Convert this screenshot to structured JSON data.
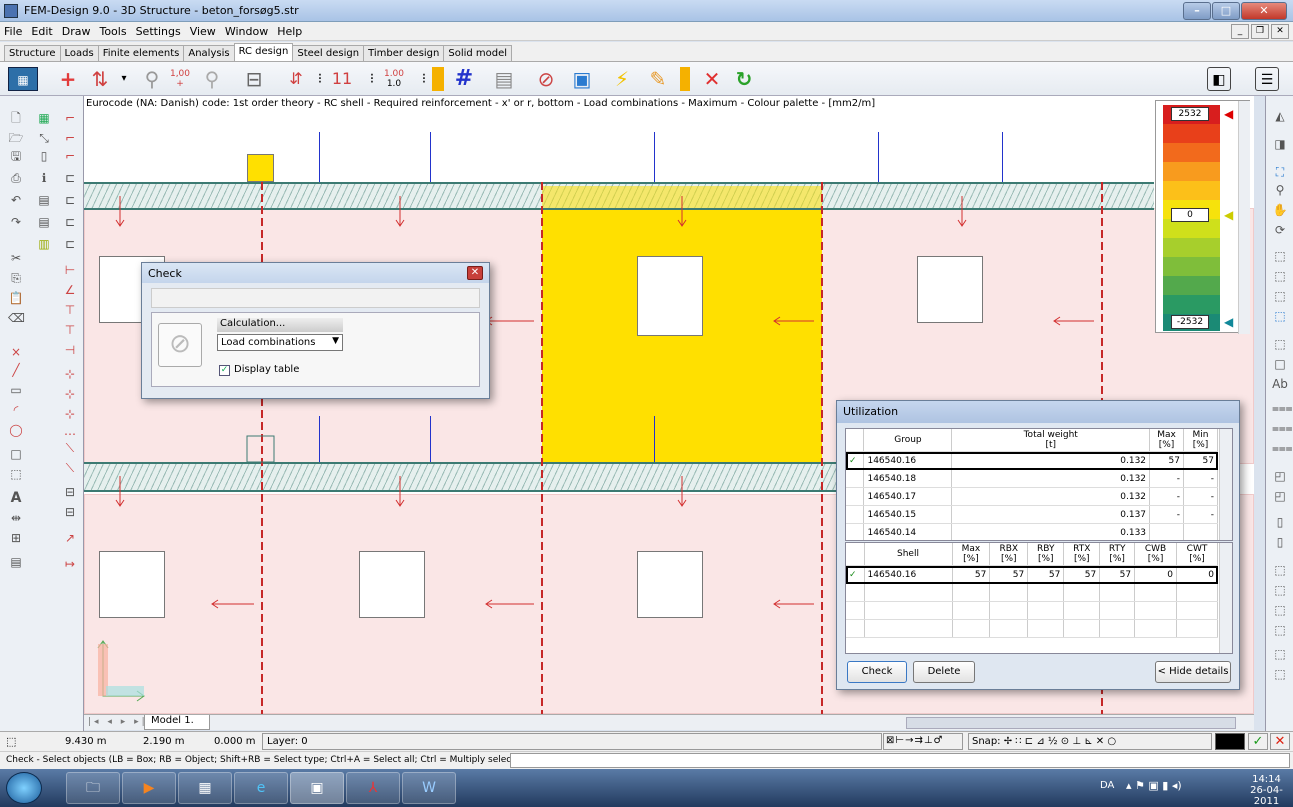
{
  "window": {
    "title": "FEM-Design 9.0 - 3D Structure - beton_forsøg5.str"
  },
  "menu": [
    "File",
    "Edit",
    "Draw",
    "Tools",
    "Settings",
    "View",
    "Window",
    "Help"
  ],
  "tabs": [
    {
      "label": "Structure",
      "active": false
    },
    {
      "label": "Loads",
      "active": false
    },
    {
      "label": "Finite elements",
      "active": false
    },
    {
      "label": "Analysis",
      "active": false
    },
    {
      "label": "RC design",
      "active": true
    },
    {
      "label": "Steel design",
      "active": false
    },
    {
      "label": "Timber design",
      "active": false
    },
    {
      "label": "Solid model",
      "active": false
    }
  ],
  "toolbar": {
    "num_a": "1,00",
    "num_b": "1.00",
    "num_c": "1.0"
  },
  "canvas": {
    "title": "Eurocode (NA: Danish) code: 1st order theory - RC shell - Required reinforcement - x' or r, bottom - Load combinations - Maximum - Colour palette - [mm2/m]"
  },
  "legend": {
    "max": "2532",
    "mid": "0",
    "min": "-2532",
    "colors": [
      "#d81e1e",
      "#e8401a",
      "#f26a1c",
      "#f89b1e",
      "#fcc019",
      "#f6e20c",
      "#cfe01b",
      "#a7cf2c",
      "#7fbe3a",
      "#53a94c",
      "#2a9a63",
      "#1b8a75"
    ]
  },
  "check_dialog": {
    "title": "Check",
    "calc_header": "Calculation...",
    "select_value": "Load combinations",
    "display_table_label": "Display table",
    "display_table_checked": true
  },
  "util_dialog": {
    "title": "Utilization",
    "group_cols": [
      "Group",
      "Total weight\n[t]",
      "Max\n[%]",
      "Min\n[%]"
    ],
    "group_rows": [
      {
        "check": "✓",
        "group": "146540.16",
        "weight": "0.132",
        "max": "57",
        "min": "57"
      },
      {
        "check": "",
        "group": "146540.18",
        "weight": "0.132",
        "max": "-",
        "min": "-"
      },
      {
        "check": "",
        "group": "146540.17",
        "weight": "0.132",
        "max": "-",
        "min": "-"
      },
      {
        "check": "",
        "group": "146540.15",
        "weight": "0.137",
        "max": "-",
        "min": "-"
      },
      {
        "check": "",
        "group": "146540.14",
        "weight": "0.133",
        "max": "",
        "min": ""
      }
    ],
    "shell_cols": [
      "Shell",
      "Max\n[%]",
      "RBX\n[%]",
      "RBY\n[%]",
      "RTX\n[%]",
      "RTY\n[%]",
      "CWB\n[%]",
      "CWT\n[%]"
    ],
    "shell_rows": [
      {
        "check": "✓",
        "shell": "146540.16",
        "max": "57",
        "rbx": "57",
        "rby": "57",
        "rtx": "57",
        "rty": "57",
        "cwb": "0",
        "cwt": "0"
      }
    ],
    "btn_check": "Check",
    "btn_delete": "Delete",
    "btn_hide": "< Hide details"
  },
  "model_tab": "Model 1.",
  "status": {
    "x": "9.430 m",
    "y": "2.190 m",
    "z": "0.000 m",
    "layer": "Layer: 0",
    "snap": "Snap:"
  },
  "command": "Check - Select objects (LB = Box; RB = Object; Shift+RB = Select type; Ctrl+A = Select all; Ctrl = Multiply selection) :",
  "taskbar": {
    "lang": "DA",
    "time": "14:14",
    "date": "26-04-2011"
  }
}
